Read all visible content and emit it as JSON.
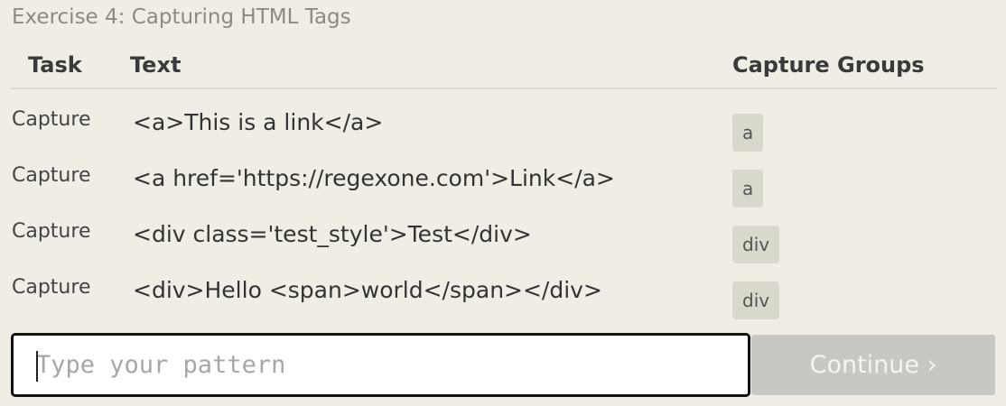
{
  "exercise": {
    "title": "Exercise 4: Capturing HTML Tags"
  },
  "table": {
    "headers": {
      "task": "Task",
      "text": "Text",
      "groups": "Capture Groups"
    },
    "rows": [
      {
        "task": "Capture",
        "text": "<a>This is a link</a>",
        "group": "a"
      },
      {
        "task": "Capture",
        "text": "<a href='https://regexone.com'>Link</a>",
        "group": "a"
      },
      {
        "task": "Capture",
        "text": "<div class='test_style'>Test</div>",
        "group": "div"
      },
      {
        "task": "Capture",
        "text": "<div>Hello <span>world</span></div>",
        "group": "div"
      }
    ]
  },
  "pattern_input": {
    "value": "",
    "placeholder": "Type your pattern"
  },
  "continue_button": {
    "label": "Continue ›"
  },
  "colors": {
    "background": "#f0ede4",
    "group_badge": "#d9d8cd",
    "button_disabled": "#c7c7c4"
  }
}
